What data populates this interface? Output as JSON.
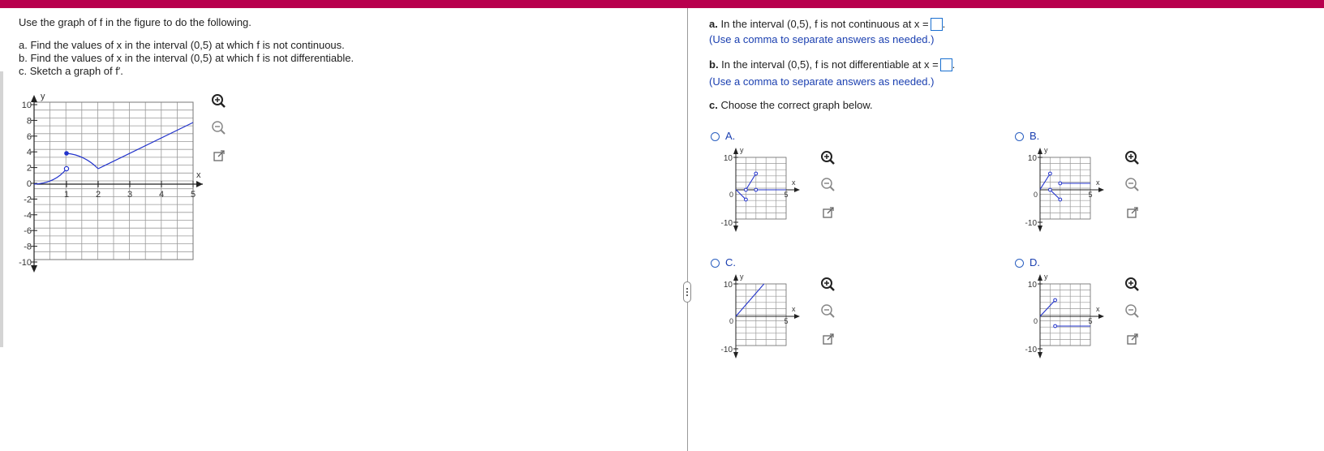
{
  "left": {
    "intro": "Use the graph of f in the figure to do the following.",
    "part_a": "a. Find the values of x in the interval (0,5) at which f is not continuous.",
    "part_b": "b. Find the values of x in the interval (0,5) at which f is not differentiable.",
    "part_c": "c. Sketch a graph of f′."
  },
  "main_graph": {
    "x_axis_label": "x",
    "y_axis_label": "y",
    "y_ticks": [
      "10",
      "8",
      "6",
      "4",
      "2",
      "0",
      "-2",
      "-4",
      "-6",
      "-8",
      "-10"
    ],
    "x_ticks": [
      "1",
      "2",
      "3",
      "4",
      "5"
    ]
  },
  "right": {
    "qa_prefix": "a.",
    "qa_text": " In the interval (0,5), f is not continuous at x =",
    "qa_hint": "(Use a comma to separate answers as needed.)",
    "qb_prefix": "b.",
    "qb_text": " In the interval (0,5), f is not differentiable at x =",
    "qb_hint": "(Use a comma to separate answers as needed.)",
    "qc_prefix": "c.",
    "qc_text": " Choose the correct graph below.",
    "options": [
      {
        "label": "A."
      },
      {
        "label": "B."
      },
      {
        "label": "C."
      },
      {
        "label": "D."
      }
    ],
    "small_graph": {
      "y_top": "10",
      "y_bottom": "-10",
      "zero": "0",
      "x_tick": "5",
      "x_label": "x",
      "y_label": "y"
    }
  },
  "colors": {
    "top_bar": "#b8004d",
    "curve": "#2233cc",
    "link_text": "#1a3fb0"
  },
  "icons": [
    "zoom-in-icon",
    "zoom-out-icon",
    "open-new-window-icon"
  ]
}
